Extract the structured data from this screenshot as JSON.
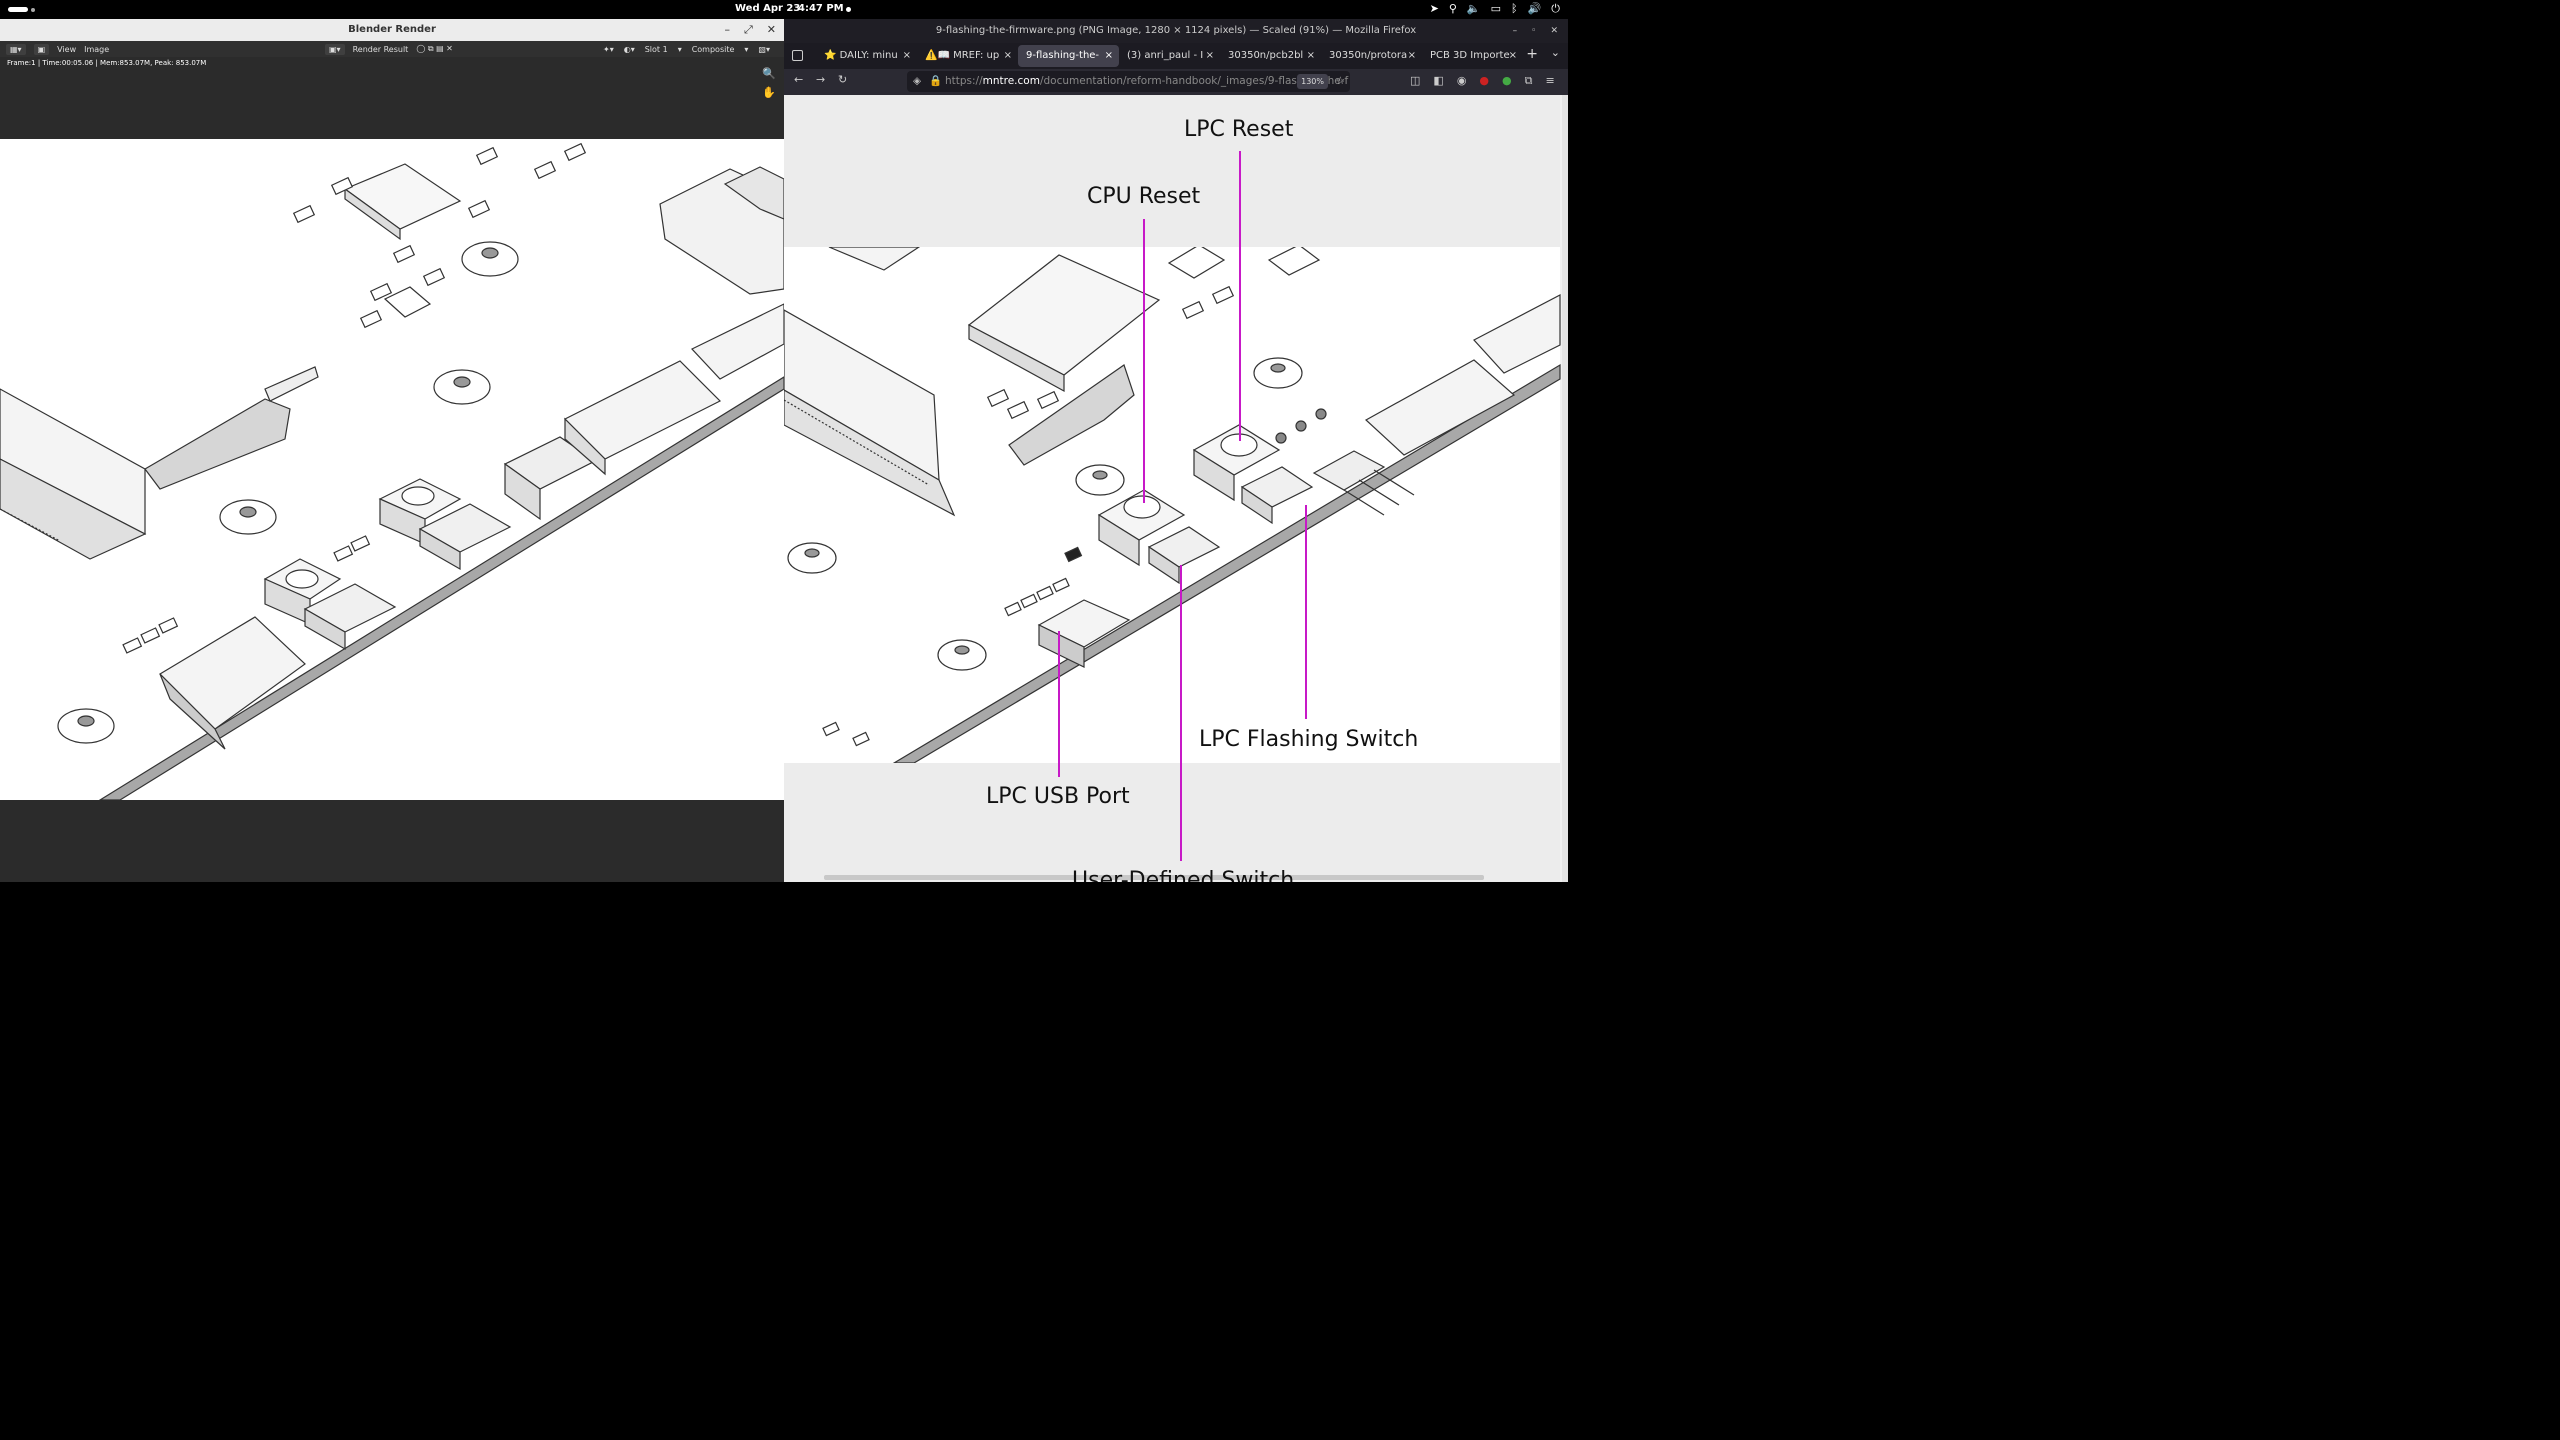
{
  "topbar": {
    "date": "Wed Apr 23",
    "time": "4:47 PM"
  },
  "blender": {
    "title": "Blender Render",
    "menu": [
      "View",
      "Image"
    ],
    "image_name": "Render Result",
    "slot": "Slot 1",
    "pass": "Composite",
    "info": "Frame:1 | Time:00:05.06 | Mem:853.07M, Peak: 853.07M"
  },
  "firefox": {
    "title": "9-flashing-the-firmware.png (PNG Image, 1280 × 1124 pixels) — Scaled (91%) — Mozilla Firefox",
    "tabs": [
      {
        "label": "⭐ DAILY: minu"
      },
      {
        "label": "⚠️📖 MREF: up"
      },
      {
        "label": "9-flashing-the-"
      },
      {
        "label": "(3) anri_paul - I"
      },
      {
        "label": "30350n/pcb2bl"
      },
      {
        "label": "30350n/protora"
      },
      {
        "label": "PCB 3D Importe"
      }
    ],
    "url_domain": "mntre.com",
    "url_scheme": "https://",
    "url_path": "/documentation/reform-handbook/_images/9-flashing-the-f",
    "zoom": "130%"
  },
  "annotations": {
    "lpc_reset": "LPC Reset",
    "cpu_reset": "CPU Reset",
    "lpc_flashing_switch": "LPC Flashing Switch",
    "lpc_usb_port": "LPC USB Port",
    "user_defined_switch": "User-Defined Switch"
  },
  "colors": {
    "leader": "#c719c7",
    "blender_bg": "#2b2b2b",
    "firefox_bg": "#1c1b22"
  }
}
